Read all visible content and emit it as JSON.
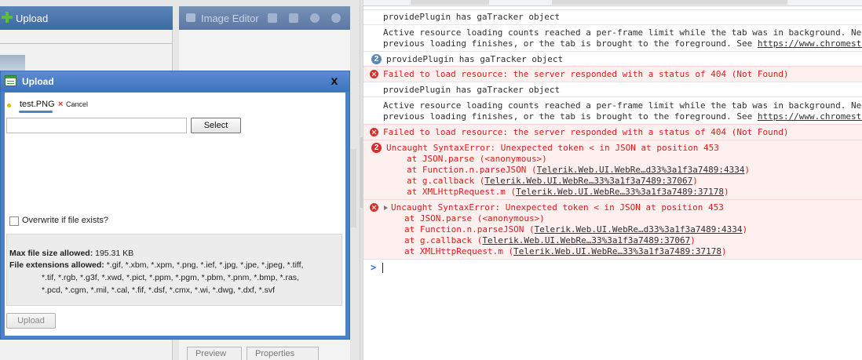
{
  "left_app": {
    "upload_toolbar_label": "Upload",
    "image_editor_label": "Image Editor",
    "bottom_tabs": [
      "Preview",
      "Properties"
    ]
  },
  "dialog": {
    "title": "Upload",
    "close_glyph": "x",
    "file_name": "test.PNG",
    "cancel_glyph": "×",
    "cancel_label": "Cancel",
    "file_input_value": "",
    "select_label": "Select",
    "overwrite_label": "Overwrite if file exists?",
    "overwrite_checked": false,
    "max_size_label": "Max file size allowed:",
    "max_size_value": "195.31 KB",
    "extensions_label": "File extensions allowed:",
    "extensions_line1": "*.gif, *.xbm, *.xpm, *.png, *.ief, *.jpg, *.jpe, *.jpeg, *.tiff,",
    "extensions_line2": "*.tif, *.rgb, *.g3f, *.xwd, *.pict, *.ppm, *.pgm, *.pbm, *.pnm, *.bmp, *.ras,",
    "extensions_line3": "*.pcd, *.cgm, *.mil, *.cal, *.fif, *.dsf, *.cmx, *.wi, *.dwg, *.dxf, *.svf",
    "upload_label": "Upload",
    "colors": {
      "titlebar": "#4a7fc8",
      "file_underline": "#4f82c6",
      "pending_dot": "#e6b800",
      "cancel_x": "#e0342a"
    }
  },
  "console": {
    "colors": {
      "error_text": "#e21b1b",
      "error_bg": "#fff0f0",
      "count_badge": "#5a88b6"
    },
    "messages": [
      {
        "text": "providePlugin has gaTracker object"
      },
      {
        "line1": "Active resource loading counts reached a per-frame limit while the tab was in background. Net",
        "line2": "previous loading finishes, or the tab is brought to the foreground. See ",
        "link": "https://www.chromesta"
      },
      {
        "count": "2",
        "text": "providePlugin has gaTracker object"
      },
      {
        "text": "Failed to load resource: the server responded with a status of 404 (Not Found)"
      },
      {
        "text": "providePlugin has gaTracker object"
      },
      {
        "line1": "Active resource loading counts reached a per-frame limit while the tab was in background. Net",
        "line2": "previous loading finishes, or the tab is brought to the foreground. See ",
        "link": "https://www.chromesta"
      },
      {
        "text": "Failed to load resource: the server responded with a status of 404 (Not Found)"
      },
      {
        "count": "2",
        "text": "Uncaught SyntaxError: Unexpected token < in JSON at position 453",
        "stack": [
          {
            "prefix": "at JSON.parse (<anonymous>)",
            "link": ""
          },
          {
            "prefix": "at Function.n.parseJSON (",
            "link": "Telerik.Web.UI.WebRe…d33%3a1f3a7489:4334",
            "suffix": ")"
          },
          {
            "prefix": "at g.callback (",
            "link": "Telerik.Web.UI.WebRe…33%3a1f3a7489:37067",
            "suffix": ")"
          },
          {
            "prefix": "at XMLHttpRequest.m (",
            "link": "Telerik.Web.UI.WebRe…33%3a1f3a7489:37178",
            "suffix": ")"
          }
        ]
      },
      {
        "text": "Uncaught SyntaxError: Unexpected token < in JSON at position 453",
        "stack": [
          {
            "prefix": "at JSON.parse (<anonymous>)",
            "link": ""
          },
          {
            "prefix": "at Function.n.parseJSON (",
            "link": "Telerik.Web.UI.WebRe…d33%3a1f3a7489:4334",
            "suffix": ")"
          },
          {
            "prefix": "at g.callback (",
            "link": "Telerik.Web.UI.WebRe…33%3a1f3a7489:37067",
            "suffix": ")"
          },
          {
            "prefix": "at XMLHttpRequest.m (",
            "link": "Telerik.Web.UI.WebRe…33%3a1f3a7489:37178",
            "suffix": ")"
          }
        ]
      }
    ],
    "prompt_glyph": ">"
  }
}
